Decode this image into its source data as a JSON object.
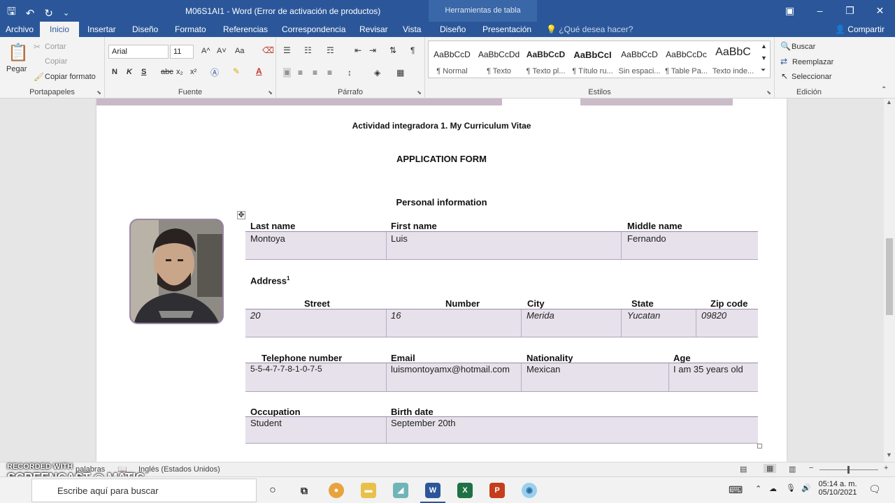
{
  "titlebar": {
    "title": "M06S1AI1 - Word (Error de activación de productos)",
    "tool_context": "Herramientas de tabla"
  },
  "tabs": [
    {
      "label": "Archivo"
    },
    {
      "label": "Inicio"
    },
    {
      "label": "Insertar"
    },
    {
      "label": "Diseño"
    },
    {
      "label": "Formato"
    },
    {
      "label": "Referencias"
    },
    {
      "label": "Correspondencia"
    },
    {
      "label": "Revisar"
    },
    {
      "label": "Vista"
    },
    {
      "label": "Diseño"
    },
    {
      "label": "Presentación"
    }
  ],
  "tell_me": "¿Qué desea hacer?",
  "share": "Compartir",
  "clipboard": {
    "paste": "Pegar",
    "cut": "Cortar",
    "copy": "Copiar",
    "format_painter": "Copiar formato",
    "label": "Portapapeles"
  },
  "font": {
    "name": "Arial",
    "size": "11",
    "label": "Fuente",
    "bold": "N",
    "italic": "K",
    "underline": "S",
    "strike": "abc",
    "sub": "x₂",
    "sup": "x²",
    "grow": "A^",
    "shrink": "A˅",
    "case": "Aa"
  },
  "paragraph": {
    "label": "Párrafo"
  },
  "styles": {
    "label": "Estilos",
    "items": [
      {
        "sample": "AaBbCcD",
        "name": "¶ Normal"
      },
      {
        "sample": "AaBbCcDd",
        "name": "¶ Texto"
      },
      {
        "sample": "AaBbCcD",
        "name": "¶ Texto pl..."
      },
      {
        "sample": "AaBbCcI",
        "name": "¶ Título ru..."
      },
      {
        "sample": "AaBbCcD",
        "name": "Sin espaci..."
      },
      {
        "sample": "AaBbCcDc",
        "name": "¶ Table Pa..."
      },
      {
        "sample": "AaBbC",
        "name": "Texto inde..."
      }
    ]
  },
  "editing": {
    "label": "Edición",
    "find": "Buscar",
    "replace": "Reemplazar",
    "select": "Seleccionar"
  },
  "document": {
    "heading": "Actividad integradora 1. My Curriculum Vitae",
    "form_title": "APPLICATION FORM",
    "section": "Personal information",
    "last_name_label": "Last name",
    "last_name": "Montoya",
    "first_name_label": "First name",
    "first_name": "Luis",
    "middle_name_label": "Middle name",
    "middle_name": "Fernando",
    "address_label": "Address",
    "address_sup": "1",
    "street_label": "Street",
    "street": "20",
    "number_label": "Number",
    "number": "16",
    "city_label": "City",
    "city": "Merida",
    "state_label": "State",
    "state": "Yucatan",
    "zip_label": "Zip code",
    "zip": "09820",
    "phone_label": "Telephone number",
    "phone": "5-5-4-7-7-8-1-0-7-5",
    "email_label": "Email",
    "email": "luismontoyamx@hotmail.com",
    "nationality_label": "Nationality",
    "nationality": "Mexican",
    "age_label": "Age",
    "age": "I am 35 years old",
    "occupation_label": "Occupation",
    "occupation": "Student",
    "birth_label": "Birth date",
    "birth": "September 20th"
  },
  "status": {
    "words": "palabras",
    "language": "Inglés (Estados Unidos)"
  },
  "watermark": {
    "line1": "RECORDED WITH",
    "line2": "SCREENCAST",
    "line3": "MATIC"
  },
  "taskbar": {
    "search_placeholder": "Escribe aquí para buscar",
    "time": "05:14 a. m.",
    "date": "05/10/2021"
  },
  "colors": {
    "titlebar": "#2b579a",
    "cell_fill": "#e6e1ea",
    "accent": "#9b87a8"
  }
}
